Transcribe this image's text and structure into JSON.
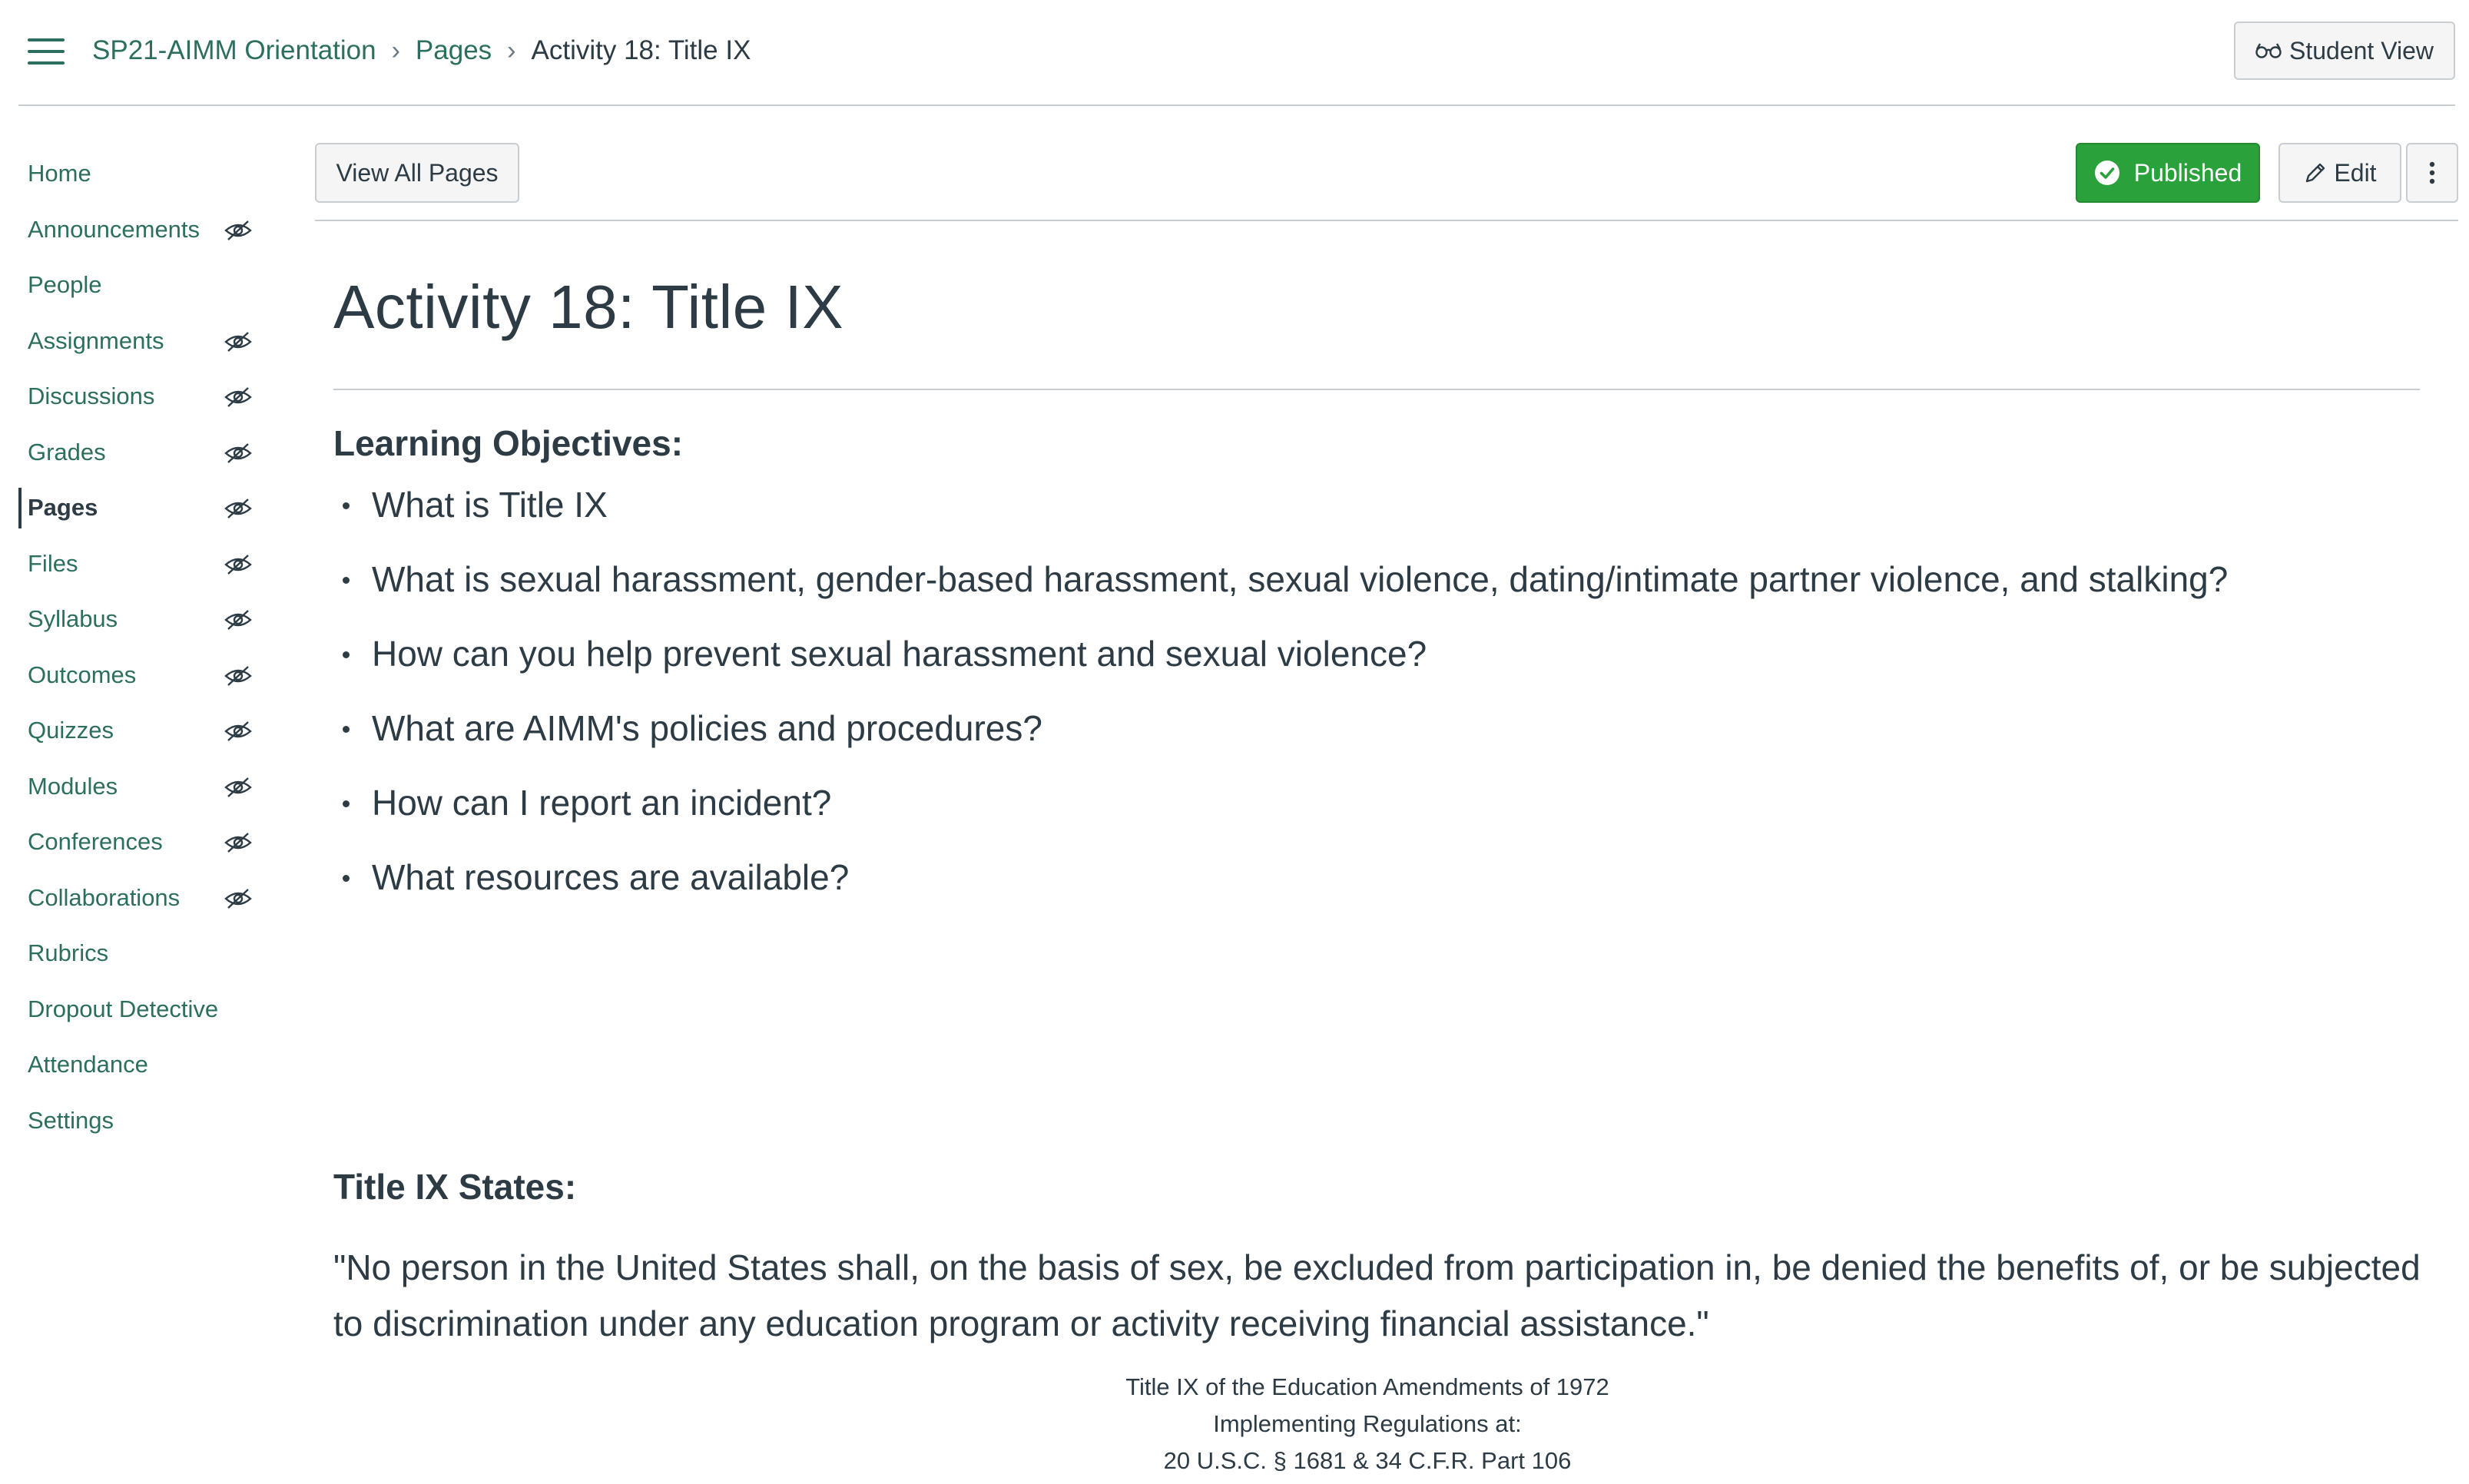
{
  "breadcrumb": {
    "course": "SP21-AIMM Orientation",
    "section": "Pages",
    "current": "Activity 18: Title IX",
    "separator": "›"
  },
  "header": {
    "student_view_label": "Student View"
  },
  "sidebar": {
    "items": [
      {
        "label": "Home",
        "hidden_icon": false
      },
      {
        "label": "Announcements",
        "hidden_icon": true
      },
      {
        "label": "People",
        "hidden_icon": false
      },
      {
        "label": "Assignments",
        "hidden_icon": true
      },
      {
        "label": "Discussions",
        "hidden_icon": true
      },
      {
        "label": "Grades",
        "hidden_icon": true
      },
      {
        "label": "Pages",
        "hidden_icon": true,
        "active": true
      },
      {
        "label": "Files",
        "hidden_icon": true
      },
      {
        "label": "Syllabus",
        "hidden_icon": true
      },
      {
        "label": "Outcomes",
        "hidden_icon": true
      },
      {
        "label": "Quizzes",
        "hidden_icon": true
      },
      {
        "label": "Modules",
        "hidden_icon": true
      },
      {
        "label": "Conferences",
        "hidden_icon": true
      },
      {
        "label": "Collaborations",
        "hidden_icon": true
      },
      {
        "label": "Rubrics",
        "hidden_icon": false
      },
      {
        "label": "Dropout Detective",
        "hidden_icon": false
      },
      {
        "label": "Attendance",
        "hidden_icon": false
      },
      {
        "label": "Settings",
        "hidden_icon": false
      }
    ]
  },
  "toolbar": {
    "view_all_label": "View All Pages",
    "published_label": "Published",
    "edit_label": "Edit"
  },
  "page": {
    "title": "Activity 18: Title IX",
    "objectives_heading": "Learning Objectives:",
    "objectives": [
      "What is Title IX",
      "What is sexual harassment, gender-based harassment, sexual violence, dating/intimate partner violence, and stalking?",
      "How can you help prevent sexual harassment and sexual violence?",
      "What are AIMM's policies and procedures?",
      "How can I report an incident?",
      "What resources are available?"
    ],
    "states_heading": "Title IX States:",
    "quote": "\"No person in the United States shall, on the basis of sex, be excluded from participation in, be denied the benefits of, or be subjected to discrimination under any education program or activity receiving financial assistance.\"",
    "citation": {
      "line1": "Title IX of the Education Amendments of 1972",
      "line2": "Implementing Regulations at:",
      "line3": "20 U.S.C. § 1681 & 34 C.F.R. Part 106"
    }
  },
  "colors": {
    "link": "#2d6f5e",
    "text": "#2d3b45",
    "published": "#2aa13b",
    "border": "#c7cdd1"
  },
  "icons": {
    "menu": "hamburger-icon",
    "student_view": "glasses-icon",
    "hidden": "eye-slash-icon",
    "published": "check-circle-icon",
    "edit": "pencil-icon",
    "more": "kebab-menu-icon"
  }
}
